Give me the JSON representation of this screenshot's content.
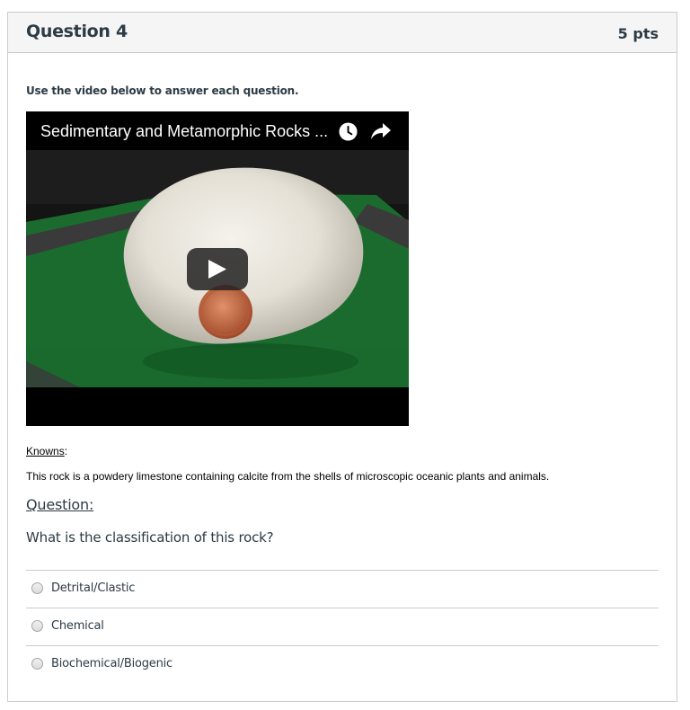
{
  "question": {
    "title": "Question 4",
    "points": "5 pts",
    "instruction": "Use the video below to answer each question.",
    "video": {
      "title": "Sedimentary and Metamorphic Rocks ...",
      "icons": [
        "clock-icon",
        "share-icon",
        "play-icon"
      ]
    },
    "knowns_label": "Knowns",
    "knowns_colon": ":",
    "known_text": "This rock is a powdery limestone containing calcite from the shells of microscopic oceanic plants and animals.",
    "question_label": "Question:",
    "question_text": "What is the classification of this rock?",
    "answers": [
      {
        "label": "Detrital/Clastic"
      },
      {
        "label": "Chemical"
      },
      {
        "label": "Biochemical/Biogenic"
      }
    ]
  },
  "colors": {
    "header_bg": "#f5f5f5",
    "border": "#c7cdd1",
    "text": "#2d3b45",
    "video_bg": "#000000"
  }
}
